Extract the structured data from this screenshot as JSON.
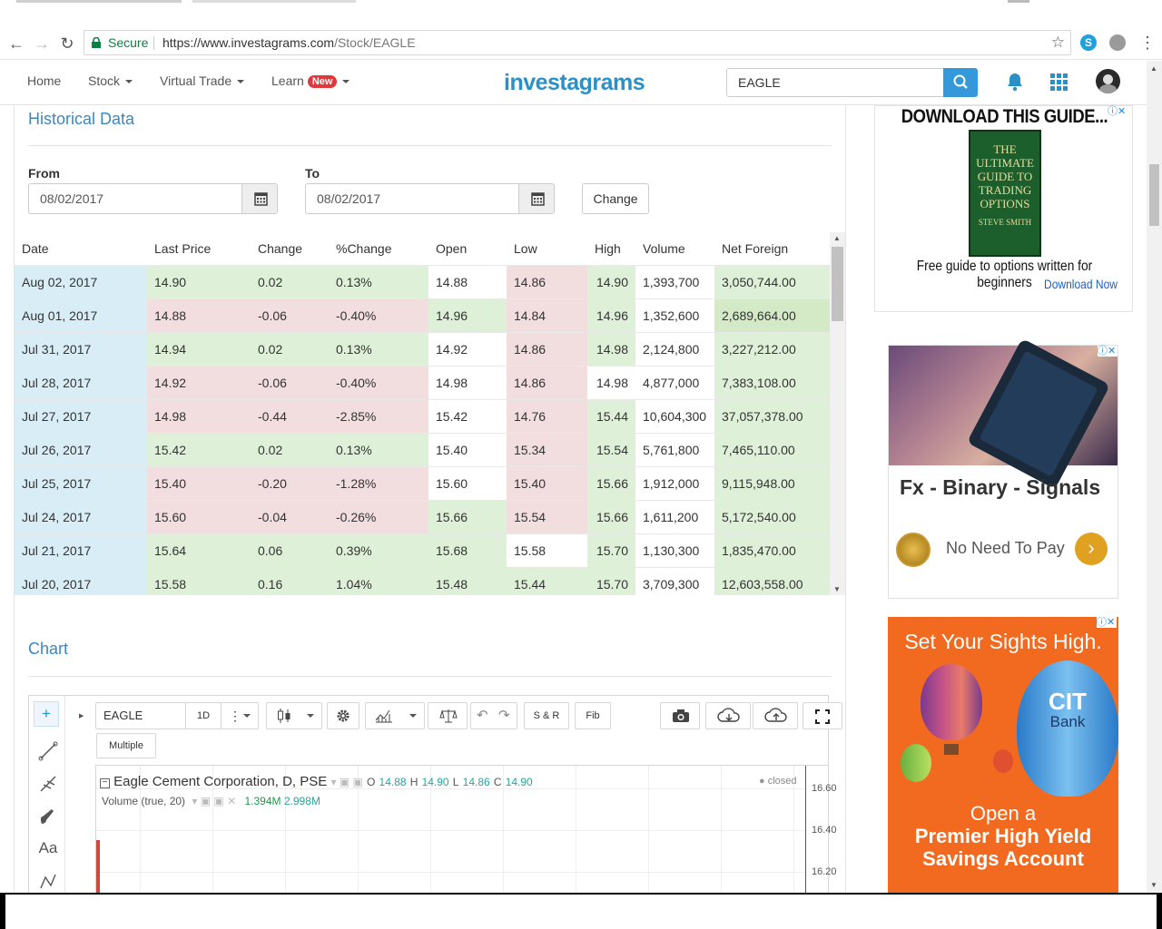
{
  "browser": {
    "secure_label": "Secure",
    "url_base": "https://www.investagrams.com",
    "url_path": "/Stock/EAGLE"
  },
  "nav": {
    "home": "Home",
    "stock": "Stock",
    "virtual_trade": "Virtual Trade",
    "learn": "Learn",
    "new_badge": "New",
    "logo": "investagrams",
    "search_value": "EAGLE"
  },
  "historical": {
    "title": "Historical Data",
    "from_label": "From",
    "to_label": "To",
    "from_value": "08/02/2017",
    "to_value": "08/02/2017",
    "change_button": "Change",
    "columns": [
      "Date",
      "Last Price",
      "Change",
      "%Change",
      "Open",
      "Low",
      "High",
      "Volume",
      "Net Foreign"
    ],
    "rows": [
      [
        "Aug 02, 2017",
        "14.90",
        "0.02",
        "0.13%",
        "14.88",
        "14.86",
        "14.90",
        "1,393,700",
        "3,050,744.00"
      ],
      [
        "Aug 01, 2017",
        "14.88",
        "-0.06",
        "-0.40%",
        "14.96",
        "14.84",
        "14.96",
        "1,352,600",
        "2,689,664.00"
      ],
      [
        "Jul 31, 2017",
        "14.94",
        "0.02",
        "0.13%",
        "14.92",
        "14.86",
        "14.98",
        "2,124,800",
        "3,227,212.00"
      ],
      [
        "Jul 28, 2017",
        "14.92",
        "-0.06",
        "-0.40%",
        "14.98",
        "14.86",
        "14.98",
        "4,877,000",
        "7,383,108.00"
      ],
      [
        "Jul 27, 2017",
        "14.98",
        "-0.44",
        "-2.85%",
        "15.42",
        "14.76",
        "15.44",
        "10,604,300",
        "37,057,378.00"
      ],
      [
        "Jul 26, 2017",
        "15.42",
        "0.02",
        "0.13%",
        "15.40",
        "15.34",
        "15.54",
        "5,761,800",
        "7,465,110.00"
      ],
      [
        "Jul 25, 2017",
        "15.40",
        "-0.20",
        "-1.28%",
        "15.60",
        "15.40",
        "15.66",
        "1,912,000",
        "9,115,948.00"
      ],
      [
        "Jul 24, 2017",
        "15.60",
        "-0.04",
        "-0.26%",
        "15.66",
        "15.54",
        "15.66",
        "1,611,200",
        "5,172,540.00"
      ],
      [
        "Jul 21, 2017",
        "15.64",
        "0.06",
        "0.39%",
        "15.68",
        "15.58",
        "15.70",
        "1,130,300",
        "1,835,470.00"
      ],
      [
        "Jul 20, 2017",
        "15.58",
        "0.16",
        "1.04%",
        "15.48",
        "15.44",
        "15.70",
        "3,709,300",
        "12,603,558.00"
      ]
    ],
    "row_colors": [
      [
        "b",
        "g",
        "g",
        "g",
        "w",
        "r",
        "g",
        "w",
        "g"
      ],
      [
        "b",
        "r",
        "r",
        "r",
        "g",
        "r",
        "g",
        "w",
        "gd"
      ],
      [
        "b",
        "g",
        "g",
        "g",
        "w",
        "r",
        "g",
        "w",
        "g"
      ],
      [
        "b",
        "r",
        "r",
        "r",
        "w",
        "r",
        "w",
        "w",
        "g"
      ],
      [
        "b",
        "r",
        "r",
        "r",
        "w",
        "r",
        "g",
        "w",
        "g"
      ],
      [
        "b",
        "g",
        "g",
        "g",
        "w",
        "r",
        "g",
        "w",
        "g"
      ],
      [
        "b",
        "r",
        "r",
        "r",
        "w",
        "r",
        "g",
        "w",
        "g"
      ],
      [
        "b",
        "r",
        "r",
        "r",
        "g",
        "r",
        "g",
        "w",
        "g"
      ],
      [
        "b",
        "g",
        "g",
        "g",
        "g",
        "w",
        "g",
        "w",
        "g"
      ],
      [
        "b",
        "g",
        "g",
        "g",
        "g",
        "g",
        "g",
        "w",
        "g"
      ]
    ]
  },
  "chart": {
    "title": "Chart",
    "symbol": "EAGLE",
    "interval": "1D",
    "snr": "S & R",
    "fib": "Fib",
    "multiple": "Multiple",
    "legend_name": "Eagle Cement Corporation, D, PSE",
    "o_label": "O",
    "o": "14.88",
    "h_label": "H",
    "h": "14.90",
    "l_label": "L",
    "l": "14.86",
    "c_label": "C",
    "c": "14.90",
    "volume_label": "Volume (true, 20)",
    "vol1": "1.394M",
    "vol2": "2.998M",
    "status": "closed",
    "axis": [
      "16.60",
      "16.40",
      "16.20"
    ],
    "text_tool": "Aa"
  },
  "ads": {
    "ad1_title": "DOWNLOAD THIS GUIDE...",
    "book_title": "THE ULTIMATE GUIDE TO TRADING OPTIONS",
    "book_author": "STEVE SMITH",
    "ad1_text": "Free guide to options written for beginners",
    "ad1_link": "Download Now",
    "ad2_title": "Fx - Binary - Signals",
    "ad2_text": "No Need To Pay",
    "ad3_title": "Set Your Sights High.",
    "ad3_brand": "CIT",
    "ad3_brand2": "Bank",
    "ad3_open": "Open a",
    "ad3_line1": "Premier High Yield",
    "ad3_line2": "Savings Account"
  }
}
